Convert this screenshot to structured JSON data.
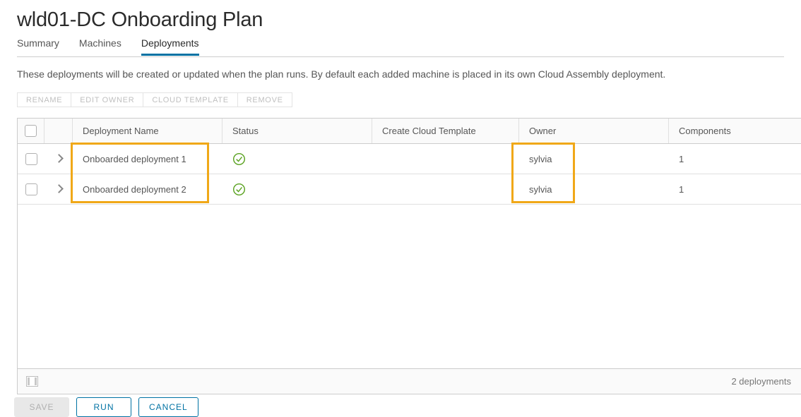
{
  "page": {
    "title": "wld01-DC Onboarding Plan",
    "description": "These deployments will be created or updated when the plan runs. By default each added machine is placed in its own Cloud Assembly deployment."
  },
  "tabs": [
    {
      "label": "Summary",
      "active": false
    },
    {
      "label": "Machines",
      "active": false
    },
    {
      "label": "Deployments",
      "active": true
    }
  ],
  "toolbar": {
    "buttons": [
      {
        "label": "RENAME",
        "disabled": true
      },
      {
        "label": "EDIT OWNER",
        "disabled": true
      },
      {
        "label": "CLOUD TEMPLATE",
        "disabled": true
      },
      {
        "label": "REMOVE",
        "disabled": true
      }
    ]
  },
  "grid": {
    "columns": [
      {
        "label": "Deployment Name"
      },
      {
        "label": "Status"
      },
      {
        "label": "Create Cloud Template"
      },
      {
        "label": "Owner"
      },
      {
        "label": "Components"
      }
    ],
    "rows": [
      {
        "name": "Onboarded deployment 1",
        "status_icon": "check-circle-icon",
        "create_cloud_template": "",
        "owner": "sylvia",
        "components": "1"
      },
      {
        "name": "Onboarded deployment 2",
        "status_icon": "check-circle-icon",
        "create_cloud_template": "",
        "owner": "sylvia",
        "components": "1"
      }
    ],
    "footer": {
      "column_picker_icon": "column-picker-icon",
      "count_label": "2 deployments"
    }
  },
  "actions": [
    {
      "label": "SAVE",
      "style": "disabled"
    },
    {
      "label": "RUN",
      "style": "outline"
    },
    {
      "label": "CANCEL",
      "style": "outline"
    }
  ],
  "colors": {
    "accent": "#0072a3",
    "highlight": "#f0a818",
    "status_success": "#5aa220",
    "text": "#565656"
  }
}
